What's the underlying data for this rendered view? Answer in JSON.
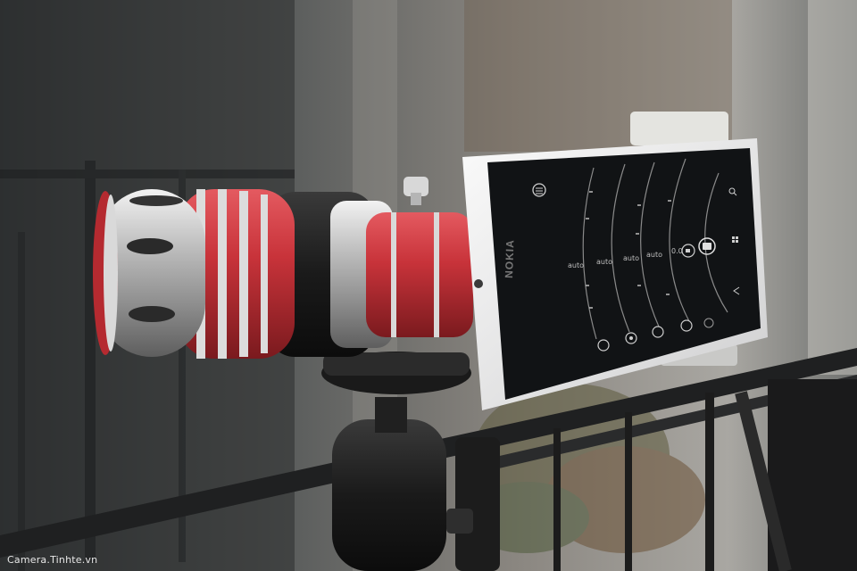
{
  "watermark": "Camera.Tinhte.vn",
  "phone": {
    "brand": "NOKIA",
    "camera_app": {
      "dial_labels": [
        "auto",
        "auto",
        "auto",
        "auto",
        "0.0"
      ]
    }
  },
  "colors": {
    "lens_red": "#c8333a",
    "lens_silver": "#c9c9c9",
    "phone_body": "#e9e9ea",
    "screen": "#1a1c1e",
    "tripod": "#1e1e1e"
  },
  "icons": [
    "menu-icon",
    "camera-shutter-icon",
    "video-icon",
    "search-icon",
    "windows-icon",
    "back-icon",
    "white-balance-icon",
    "focus-icon",
    "iso-icon",
    "exposure-icon",
    "flash-icon"
  ]
}
